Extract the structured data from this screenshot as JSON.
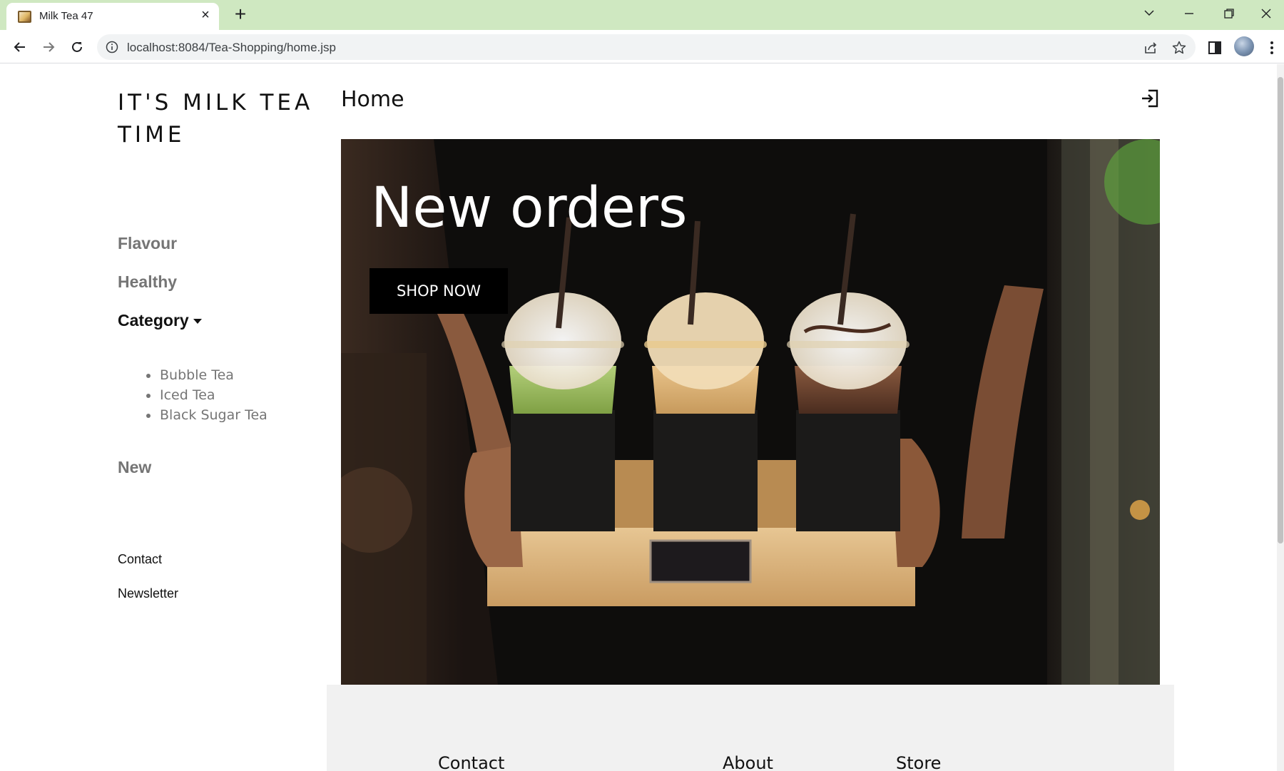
{
  "browser": {
    "tab_title": "Milk Tea 47",
    "url": "localhost:8084/Tea-Shopping/home.jsp"
  },
  "sidebar": {
    "brand": "IT'S MILK TEA TIME",
    "links": {
      "flavour": "Flavour",
      "healthy": "Healthy",
      "category": "Category",
      "new": "New"
    },
    "category_items": [
      "Bubble Tea",
      "Iced Tea",
      "Black Sugar Tea"
    ],
    "contact": "Contact",
    "newsletter": "Newsletter"
  },
  "main": {
    "title": "Home",
    "hero": {
      "heading": "New orders",
      "button": "SHOP NOW"
    }
  },
  "footer": {
    "headings": [
      "Contact",
      "About",
      "Store"
    ]
  },
  "colors": {
    "tabstrip": "#cfe8c1",
    "text": "#111111",
    "muted_text": "#757575",
    "button_bg": "#000000",
    "footer_bg": "#f1f1f1"
  }
}
